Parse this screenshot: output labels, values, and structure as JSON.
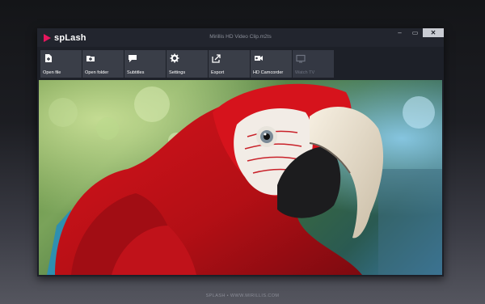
{
  "app": {
    "logo_text": "spLash",
    "window_title": "Mirillis HD Video Clip.m2ts",
    "brand_color": "#e7175e"
  },
  "window_controls": {
    "minimize": "–",
    "maximize": "▭",
    "close": "✕"
  },
  "toolbar": {
    "buttons": [
      {
        "label": "Open file",
        "icon": "open-file-icon"
      },
      {
        "label": "Open folder",
        "icon": "open-folder-icon"
      },
      {
        "label": "Subtitles",
        "icon": "subtitles-icon"
      },
      {
        "label": "Settings",
        "icon": "gear-icon"
      },
      {
        "label": "Export",
        "icon": "export-icon"
      },
      {
        "label": "HD Camcorder",
        "icon": "camcorder-icon"
      },
      {
        "label": "Watch TV",
        "icon": "tv-icon",
        "disabled": true
      }
    ]
  },
  "video": {
    "content": "video-frame-parrot"
  },
  "footer": {
    "text": "SPLASH • WWW.MIRILLIS.COM"
  }
}
